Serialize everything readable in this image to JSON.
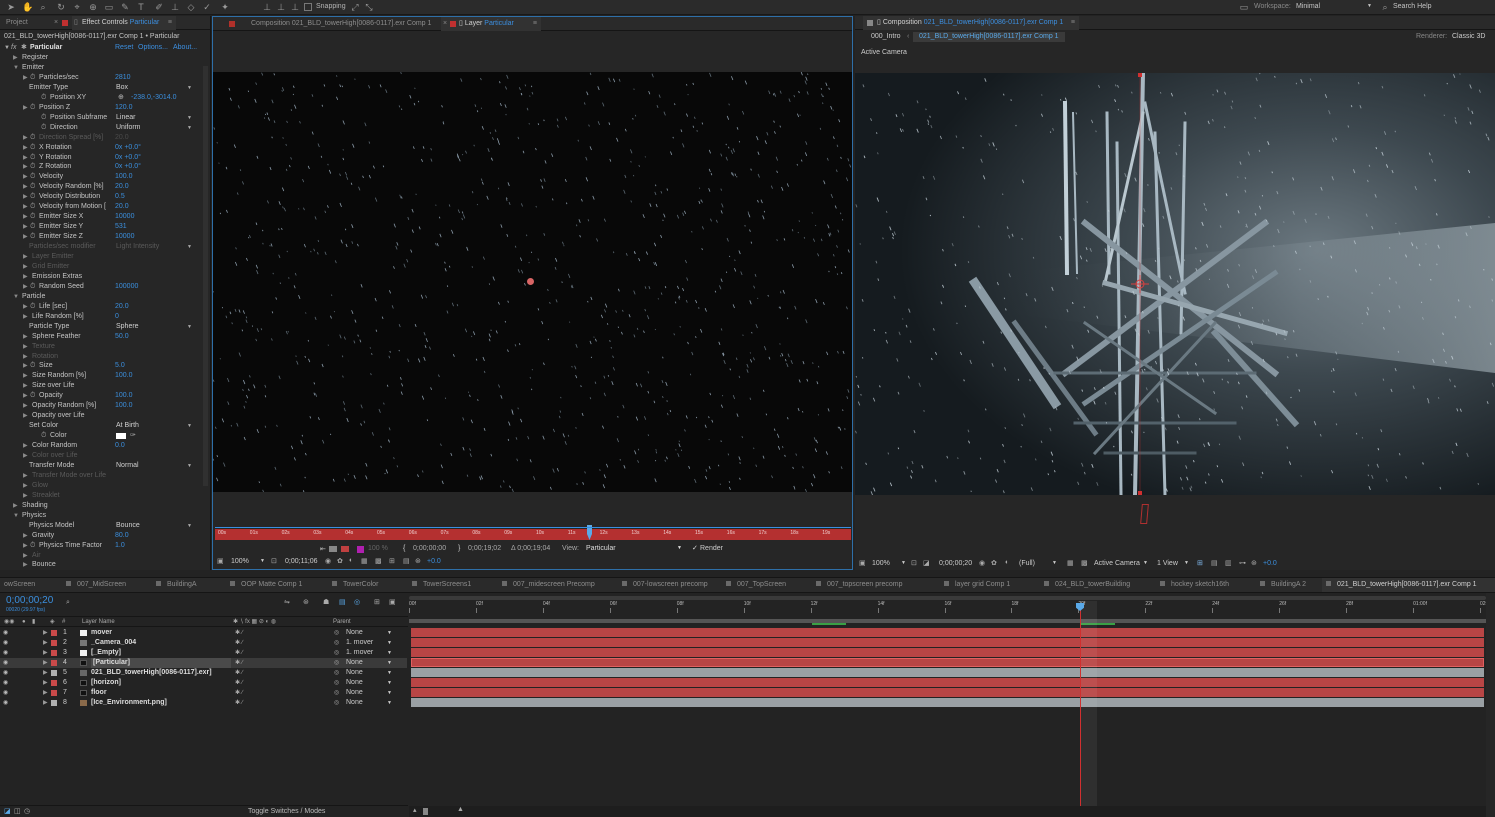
{
  "toolbar": {
    "snapping": "Snapping",
    "workspace_label": "Workspace:",
    "workspace_value": "Minimal",
    "search_help": "Search Help"
  },
  "left_panel": {
    "tabs": [
      "Project",
      "Effect Controls",
      "Particular"
    ],
    "comp_path": "021_BLD_towerHigh[0086-0117].exr Comp 1 • Particular",
    "effect_name": "Particular",
    "reset": "Reset",
    "options": "Options...",
    "about": "About...",
    "rows": [
      {
        "t": "▶",
        "label": "Register",
        "indent": 0
      },
      {
        "t": "▼",
        "label": "Emitter",
        "indent": 0
      },
      {
        "t": "▶",
        "sw": true,
        "label": "Particles/sec",
        "val": "2810",
        "indent": 1
      },
      {
        "label": "Emitter Type",
        "dd": "Box",
        "indent": 1
      },
      {
        "sw": true,
        "label": "Position XY",
        "val": "-238.0,-3014.0",
        "indent": 2,
        "cross": true
      },
      {
        "t": "▶",
        "sw": true,
        "label": "Position Z",
        "val": "120.0",
        "indent": 1
      },
      {
        "sw": true,
        "label": "Position Subframe",
        "dd": "Linear",
        "indent": 2
      },
      {
        "sw": true,
        "label": "Direction",
        "dd": "Uniform",
        "indent": 2
      },
      {
        "t": "▶",
        "sw": true,
        "label": "Direction Spread [%]",
        "val": "20.0",
        "indent": 1,
        "dim": true
      },
      {
        "t": "▶",
        "sw": true,
        "label": "X Rotation",
        "val": "0x +0.0°",
        "indent": 1
      },
      {
        "t": "▶",
        "sw": true,
        "label": "Y Rotation",
        "val": "0x +0.0°",
        "indent": 1
      },
      {
        "t": "▶",
        "sw": true,
        "label": "Z Rotation",
        "val": "0x +0.0°",
        "indent": 1
      },
      {
        "t": "▶",
        "sw": true,
        "label": "Velocity",
        "val": "100.0",
        "indent": 1
      },
      {
        "t": "▶",
        "sw": true,
        "label": "Velocity Random [%]",
        "val": "20.0",
        "indent": 1
      },
      {
        "t": "▶",
        "sw": true,
        "label": "Velocity Distribution",
        "val": "0.5",
        "indent": 1
      },
      {
        "t": "▶",
        "sw": true,
        "label": "Velocity from Motion [",
        "val": "20.0",
        "indent": 1
      },
      {
        "t": "▶",
        "sw": true,
        "label": "Emitter Size X",
        "val": "10000",
        "indent": 1
      },
      {
        "t": "▶",
        "sw": true,
        "label": "Emitter Size Y",
        "val": "531",
        "indent": 1
      },
      {
        "t": "▶",
        "sw": true,
        "label": "Emitter Size Z",
        "val": "10000",
        "indent": 1
      },
      {
        "label": "Particles/sec modifier",
        "dd": "Light Intensity",
        "indent": 1,
        "dim": true
      },
      {
        "t": "▶",
        "label": "Layer Emitter",
        "indent": 1,
        "dim": true
      },
      {
        "t": "▶",
        "label": "Grid Emitter",
        "indent": 1,
        "dim": true
      },
      {
        "t": "▶",
        "label": "Emission Extras",
        "indent": 1
      },
      {
        "t": "▶",
        "sw": true,
        "label": "Random Seed",
        "val": "100000",
        "indent": 1
      },
      {
        "t": "▼",
        "label": "Particle",
        "indent": 0
      },
      {
        "t": "▶",
        "sw": true,
        "label": "Life [sec]",
        "val": "20.0",
        "indent": 1
      },
      {
        "t": "▶",
        "label": "Life Random [%]",
        "val": "0",
        "indent": 1
      },
      {
        "label": "Particle Type",
        "dd": "Sphere",
        "indent": 1
      },
      {
        "t": "▶",
        "label": "Sphere Feather",
        "val": "50.0",
        "indent": 1
      },
      {
        "t": "▶",
        "label": "Texture",
        "indent": 1,
        "dim": true
      },
      {
        "t": "▶",
        "label": "Rotation",
        "indent": 1,
        "dim": true
      },
      {
        "t": "▶",
        "sw": true,
        "label": "Size",
        "val": "5.0",
        "indent": 1
      },
      {
        "t": "▶",
        "label": "Size Random [%]",
        "val": "100.0",
        "indent": 1
      },
      {
        "t": "▶",
        "label": "Size over Life",
        "indent": 1
      },
      {
        "t": "▶",
        "sw": true,
        "label": "Opacity",
        "val": "100.0",
        "indent": 1
      },
      {
        "t": "▶",
        "label": "Opacity Random [%]",
        "val": "100.0",
        "indent": 1
      },
      {
        "t": "▶",
        "label": "Opacity over Life",
        "indent": 1
      },
      {
        "label": "Set Color",
        "dd": "At Birth",
        "indent": 1
      },
      {
        "sw": true,
        "label": "Color",
        "indent": 2,
        "swatch": true
      },
      {
        "t": "▶",
        "label": "Color Random",
        "val": "0.0",
        "indent": 1
      },
      {
        "t": "▶",
        "label": "Color over Life",
        "indent": 1,
        "dim": true
      },
      {
        "label": "Transfer Mode",
        "dd": "Normal",
        "indent": 1
      },
      {
        "t": "▶",
        "label": "Transfer Mode over Life",
        "indent": 1,
        "dim": true
      },
      {
        "t": "▶",
        "label": "Glow",
        "indent": 1,
        "dim": true
      },
      {
        "t": "▶",
        "label": "Streaklet",
        "indent": 1,
        "dim": true
      },
      {
        "t": "▶",
        "label": "Shading",
        "indent": 0
      },
      {
        "t": "▼",
        "label": "Physics",
        "indent": 0
      },
      {
        "label": "Physics Model",
        "dd": "Bounce",
        "indent": 1
      },
      {
        "t": "▶",
        "label": "Gravity",
        "val": "80.0",
        "indent": 1
      },
      {
        "t": "▶",
        "sw": true,
        "label": "Physics Time Factor",
        "val": "1.0",
        "indent": 1
      },
      {
        "t": "▶",
        "label": "Air",
        "indent": 1,
        "dim": true
      },
      {
        "t": "▶",
        "label": "Bounce",
        "indent": 1
      }
    ]
  },
  "layer_viewer": {
    "tab_comp": "Composition 021_BLD_towerHigh[0086-0117].exr Comp 1",
    "tab_layer_prefix": "Layer",
    "tab_layer_name": "Particular",
    "ruler": [
      "00s",
      "01s",
      "02s",
      "03s",
      "04s",
      "05s",
      "06s",
      "07s",
      "08s",
      "09s",
      "10s",
      "11s",
      "12s",
      "13s",
      "14s",
      "15s",
      "16s",
      "17s",
      "18s",
      "19s"
    ],
    "zoom": "100%",
    "timecode": "0;00;11;06",
    "res": "100 %",
    "in_point": "0;00;00;00",
    "out_point": "0;00;19;02",
    "duration": "Δ 0;00;19;04",
    "view_label": "View:",
    "view_value": "Particular",
    "render": "Render"
  },
  "comp_viewer": {
    "tab_label": "Composition",
    "tab_name": "021_BLD_towerHigh[0086-0117].exr Comp 1",
    "crumb1": "000_Intro",
    "crumb2": "021_BLD_towerHigh[0086-0117].exr Comp 1",
    "renderer_label": "Renderer:",
    "renderer_value": "Classic 3D",
    "active_camera": "Active Camera",
    "zoom": "100%",
    "timecode": "0;00;00;20",
    "quality": "(Full)",
    "camera_dd": "Active Camera",
    "views_dd": "1 View",
    "offset": "+0.0"
  },
  "timeline": {
    "tabs": [
      "owScreen",
      "007_MidScreen",
      "BuildingA",
      "OOP Matte Comp 1",
      "TowerColor",
      "TowerScreens1",
      "007_midescreen Precomp",
      "007-lowscreen precomp",
      "007_TopScreen",
      "007_topscreen precomp",
      "layer grid Comp 1",
      "024_BLD_towerBuilding",
      "hockey sketch16th",
      "BuildingA 2",
      "021_BLD_towerHigh[0086-0117].exr Comp 1"
    ],
    "current_time": "0;00;00;20",
    "fps": "00020 (29.97 fps)",
    "col_layer_name": "Layer Name",
    "col_parent": "Parent",
    "ruler": [
      "00f",
      "02f",
      "04f",
      "06f",
      "08f",
      "10f",
      "12f",
      "14f",
      "16f",
      "18f",
      "20f",
      "22f",
      "24f",
      "26f",
      "28f",
      "01:00f",
      "02f"
    ],
    "layers": [
      {
        "num": "1",
        "name": "mover",
        "parent": "None",
        "color": "#c94a4a",
        "icon": "white"
      },
      {
        "num": "2",
        "name": "_Camera_004",
        "parent": "1. mover",
        "color": "#c94a4a",
        "icon": "camera"
      },
      {
        "num": "3",
        "name": "[_Empty]",
        "parent": "1. mover",
        "color": "#c94a4a",
        "icon": "white"
      },
      {
        "num": "4",
        "name": "[Particular]",
        "parent": "None",
        "color": "#c94a4a",
        "icon": "black",
        "selected": true
      },
      {
        "num": "5",
        "name": "021_BLD_towerHigh[0086-0117].exr]",
        "parent": "None",
        "color": "#b0b0b0",
        "icon": "footage"
      },
      {
        "num": "6",
        "name": "[horizon]",
        "parent": "None",
        "color": "#c94a4a",
        "icon": "black"
      },
      {
        "num": "7",
        "name": "floor",
        "parent": "None",
        "color": "#c94a4a",
        "icon": "black"
      },
      {
        "num": "8",
        "name": "[Ice_Environment.png]",
        "parent": "None",
        "color": "#b0b0b0",
        "icon": "image"
      }
    ],
    "toggle_label": "Toggle Switches / Modes"
  }
}
